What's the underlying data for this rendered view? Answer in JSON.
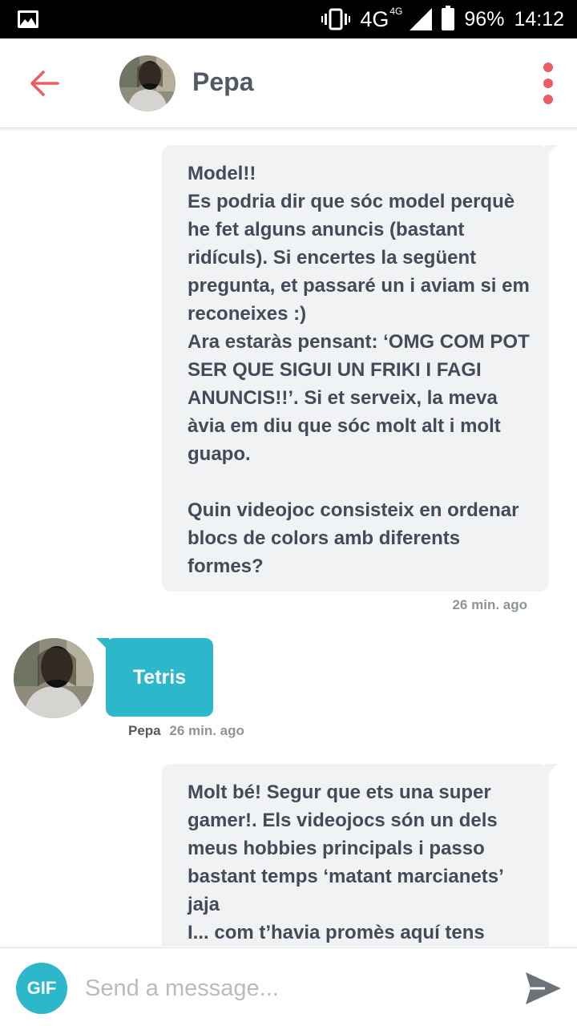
{
  "status_bar": {
    "network": "4G",
    "network_small": "4G",
    "battery": "96%",
    "time": "14:12",
    "icons": [
      "gallery-icon",
      "vibrate-icon",
      "signal-icon",
      "battery-icon"
    ]
  },
  "header": {
    "contact_name": "Pepa",
    "icons": [
      "back-arrow-icon",
      "more-vert-icon"
    ]
  },
  "messages": [
    {
      "direction": "outgoing",
      "text": "Model!!\nEs podria dir que sóc model perquè he fet alguns anuncis (bastant ridículs). Si encertes la següent pregunta, et passaré un i aviam si em reconeixes :)\nAra estaràs pensant: ‘OMG COM POT SER QUE SIGUI UN FRIKI I FAGI ANUNCIS!!’. Si et serveix, la meva àvia em diu que sóc molt alt i molt guapo.\n\nQuin videojoc consisteix en ordenar blocs de colors amb diferents formes?",
      "time": "26 min. ago"
    },
    {
      "direction": "incoming",
      "sender": "Pepa",
      "text": "Tetris",
      "time": "26 min. ago"
    },
    {
      "direction": "outgoing",
      "text": "Molt bé! Segur que ets una super gamer!. Els videojocs són un dels meus hobbies principals i passo bastant temps ‘matant marcianets’ jaja\nI... com t’havia promès aquí tens"
    }
  ],
  "composer": {
    "gif_label": "GIF",
    "placeholder": "Send a message...",
    "icons": [
      "send-icon"
    ]
  },
  "colors": {
    "accent": "#ef5b62",
    "incoming_bubble": "#2db7ca",
    "outgoing_bubble": "#f1f2f4",
    "text": "#414c58"
  }
}
